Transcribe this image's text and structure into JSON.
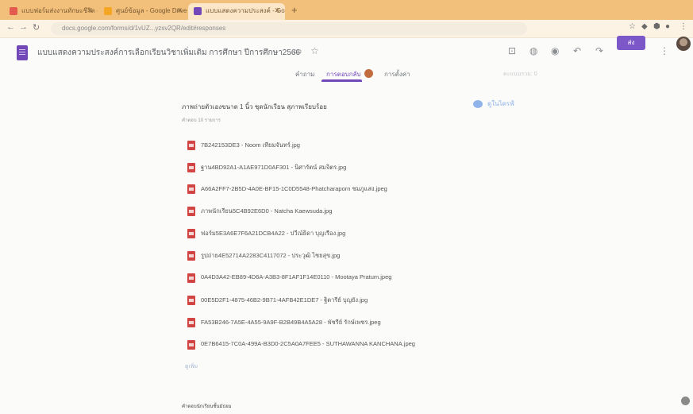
{
  "browser": {
    "tabs": [
      {
        "label": "แบบฟอร์มส่งงานทักษะชีวิต - G",
        "color": "#e35b4f"
      },
      {
        "label": "ศูนย์ข้อมูล - Google Drive",
        "color": "#f5a623"
      },
      {
        "label": "แบบแสดงความประสงค์ - Google Forms",
        "color": "#7248b9"
      }
    ],
    "new_tab": "+",
    "address": "docs.google.com/forms/d/1vUZ...yzsv2QR/edit#responses"
  },
  "form": {
    "title": "แบบแสดงความประสงค์การเลือกเรียนวิชาเพิ่มเติม การศึกษา ปีการศึกษา2566",
    "send_label": "ส่ง"
  },
  "nav_tabs": {
    "questions": "คำถาม",
    "responses": "การตอบกลับ",
    "settings": "การตั้งค่า",
    "responses_count": "2"
  },
  "toolbar_note": "คะแนนรวม: 0",
  "question": {
    "title": "ภาพถ่ายตัวเองขนาด 1 นิ้ว ชุดนักเรียน สุภาพเรียบร้อย",
    "subtitle": "คำตอบ 10 รายการ",
    "drive_link": "ดูในไดรฟ์"
  },
  "files": [
    {
      "name": "7B242153DE3 - Noom เทียมจันทร์.jpg"
    },
    {
      "name": "ฐาน4BD92A1-A1AE971D0AF301 - นิศารัตน์ สมจิตร.jpg"
    },
    {
      "name": "A66A2FF7-2B5D-4A0E-BF15-1C0D5548-Phatcharaporn ชมภูแสง.jpeg"
    },
    {
      "name": "ภาพนักเรียน5C4B92E6D0 - Natcha Kaewsuda.jpg"
    },
    {
      "name": "ฟอร์ม5E3A6E7F6A21DCB4A22 - ปวีณ์ธิดา บุญเรือง.jpg"
    },
    {
      "name": "รูปถ่าย4E52714A2283C4117072 - ประวุฒิ ไชยสุข.jpg"
    },
    {
      "name": "0A4D3A42-EB89-4D6A-A3B3-8F1AF1F14E0110 - Mootaya Pratum.jpeg"
    },
    {
      "name": "00E5D2F1-4875-46B2-9B71-4AFB42E1DE7 - ฐิตารีย์ บุญยัง.jpg"
    },
    {
      "name": "FA53B246-7A5E-4A55-9A9F-B2B49B4A5A28 - พัชรีย์ รักษ์เพชร.jpeg"
    },
    {
      "name": "0E7B6415-7C0A-499A-B3D0-2C5A0A7FEE5 - SUTHAWANNA KANCHANA.jpeg"
    }
  ],
  "more_label": "ดูเพิ่ม",
  "footer": "คำตอบนักเรียนชั้นมัธยม",
  "colors": {
    "accent": "#7248b9",
    "file_icon": "#d14545",
    "tabbar": "#f2c07a"
  }
}
